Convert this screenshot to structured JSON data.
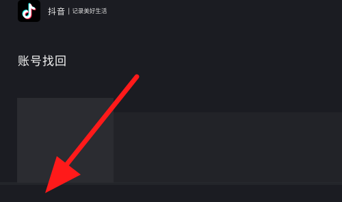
{
  "header": {
    "app_name": "抖音",
    "divider": "|",
    "slogan": "记录美好生活"
  },
  "page": {
    "title": "账号找回"
  },
  "annotation": {
    "arrow_color": "#ff1a1a"
  },
  "colors": {
    "background": "#1b1c22",
    "panel": "#2b2c31",
    "panel_dark": "#222328",
    "logo_cyan": "#25f4ee",
    "logo_red": "#fe2c55"
  }
}
